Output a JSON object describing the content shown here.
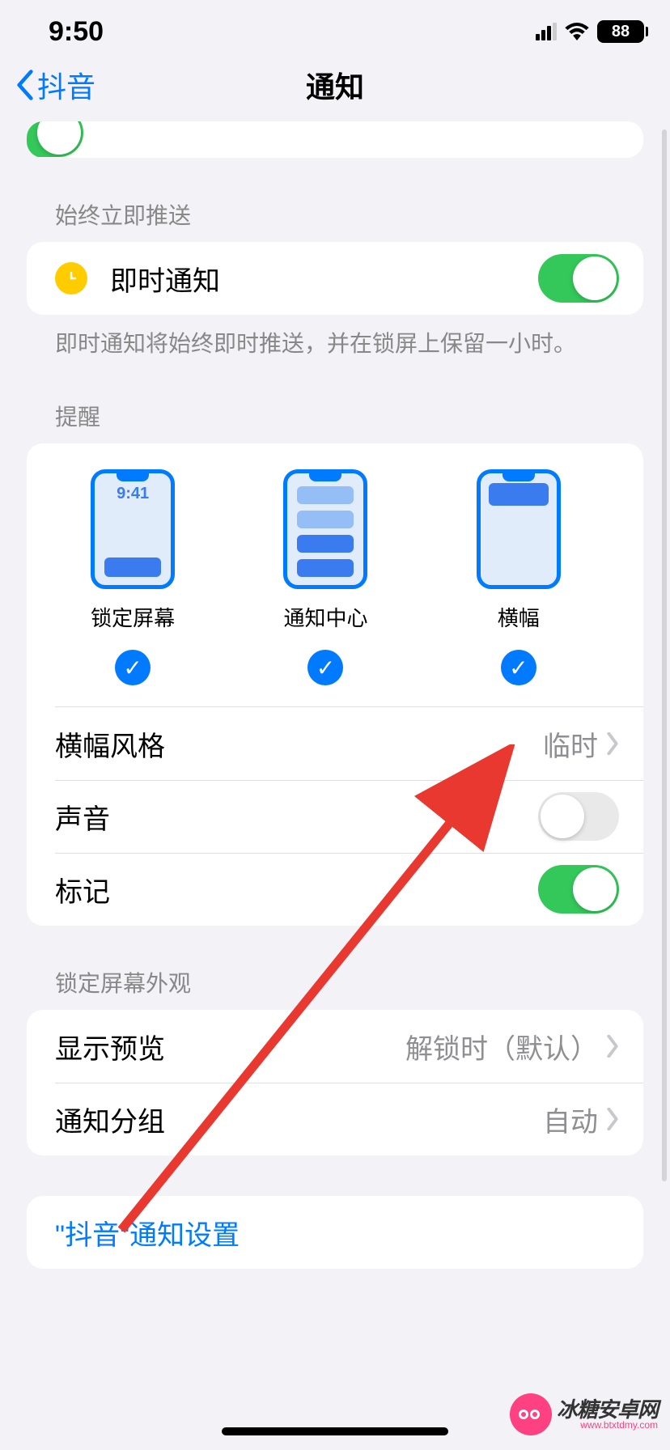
{
  "status": {
    "time": "9:50",
    "battery": "88"
  },
  "nav": {
    "back": "抖音",
    "title": "通知"
  },
  "sections": {
    "immediate_header": "始终立即推送",
    "immediate_label": "即时通知",
    "immediate_footer": "即时通知将始终即时推送，并在锁屏上保留一小时。",
    "alerts_header": "提醒",
    "lock_appearance_header": "锁定屏幕外观"
  },
  "alert_styles": {
    "lock_screen": "锁定屏幕",
    "notification_center": "通知中心",
    "banner": "横幅",
    "lock_time_preview": "9:41"
  },
  "rows": {
    "banner_style": {
      "label": "横幅风格",
      "value": "临时"
    },
    "sound": {
      "label": "声音"
    },
    "badge": {
      "label": "标记"
    },
    "show_preview": {
      "label": "显示预览",
      "value": "解锁时（默认）"
    },
    "grouping": {
      "label": "通知分组",
      "value": "自动"
    },
    "app_settings": {
      "label": "\"抖音\"通知设置"
    }
  },
  "watermark": {
    "text": "冰糖安卓网",
    "sub": "www.btxtdmy.com"
  }
}
